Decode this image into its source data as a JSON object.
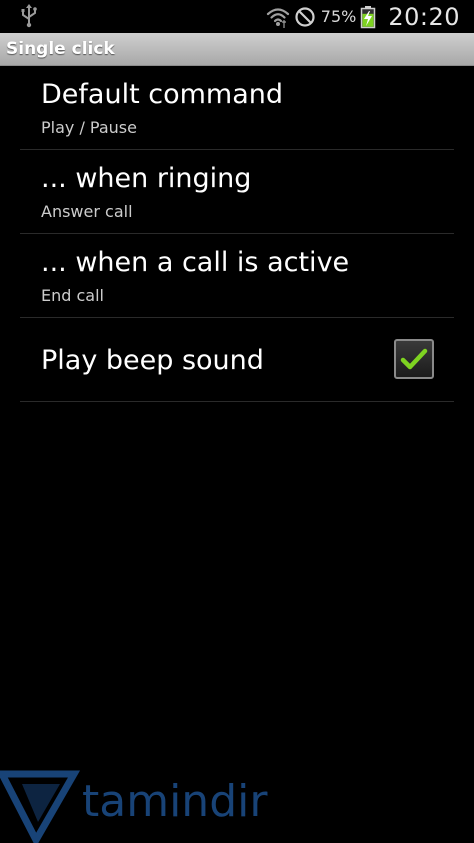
{
  "status_bar": {
    "battery_percent": "75%",
    "time": "20:20",
    "icons": [
      "usb-icon",
      "wifi-icon",
      "no-sign-icon",
      "battery-charging-icon"
    ],
    "battery_level": 0.75,
    "battery_color": "#7ed321"
  },
  "title_bar": {
    "title": "Single click"
  },
  "preferences": [
    {
      "title": "Default command",
      "summary": "Play / Pause"
    },
    {
      "title": "... when ringing",
      "summary": "Answer call"
    },
    {
      "title": "... when a call is active",
      "summary": "End call"
    },
    {
      "title": "Play beep sound",
      "checked": true
    }
  ],
  "watermark": {
    "text": "tamindir",
    "color": "#1d4f8c"
  },
  "colors": {
    "background": "#000000",
    "title_bar": "#bdbdbd",
    "divider": "#2a2a2a",
    "checkmark": "#7ed321"
  }
}
